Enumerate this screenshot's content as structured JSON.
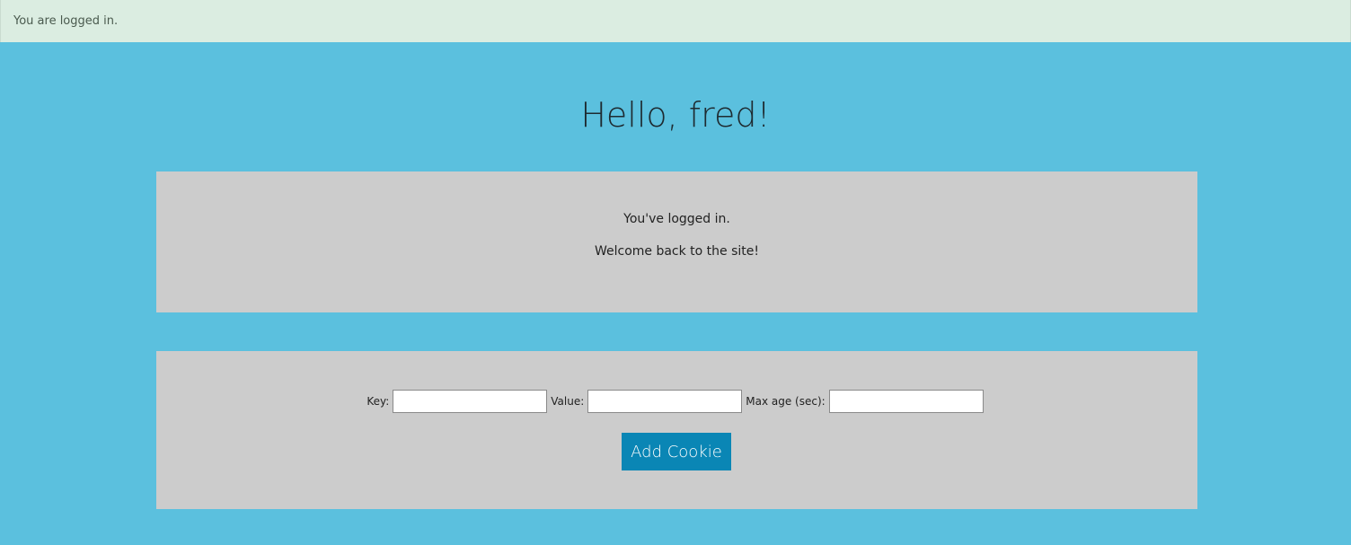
{
  "flash": {
    "message": "You are logged in."
  },
  "page": {
    "title": "Hello, fred!"
  },
  "welcome_panel": {
    "line1": "You've logged in.",
    "line2": "Welcome back to the site!"
  },
  "cookie_form": {
    "key_label": "Key:",
    "key_value": "",
    "value_label": "Value:",
    "value_value": "",
    "max_age_label": "Max age (sec):",
    "max_age_value": "",
    "submit_label": "Add Cookie"
  },
  "colors": {
    "background": "#5bc0de",
    "flash_background": "#dbede1",
    "panel_background": "#cccccc",
    "button_background": "#0a86b5"
  }
}
